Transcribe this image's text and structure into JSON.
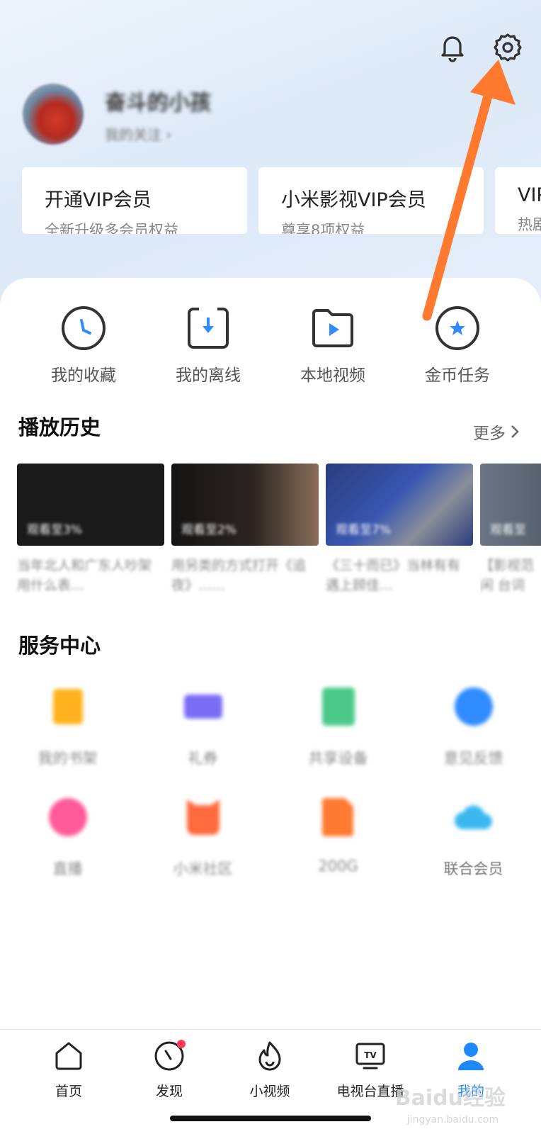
{
  "profile": {
    "nickname": "奋斗的小孩",
    "follow": "我的关注 ›"
  },
  "vip_cards": [
    {
      "title": "开通VIP会员",
      "subtitle": "全新升级多会员权益"
    },
    {
      "title": "小米影视VIP会员",
      "subtitle": "尊享8项权益"
    },
    {
      "title": "VIP",
      "subtitle": "热剧"
    }
  ],
  "quick_actions": [
    {
      "label": "我的收藏",
      "icon": "clock-icon"
    },
    {
      "label": "我的离线",
      "icon": "download-icon"
    },
    {
      "label": "本地视频",
      "icon": "folder-play-icon"
    },
    {
      "label": "金币任务",
      "icon": "star-coin-icon"
    }
  ],
  "history": {
    "title": "播放历史",
    "more": "更多",
    "items": [
      {
        "progress": "观看至3%",
        "title": "当年北人和广东人吵架用什么表…"
      },
      {
        "progress": "观看至2%",
        "title": "用另类的方式打开《追夜》……"
      },
      {
        "progress": "观看至7%",
        "title": "《三十而已》当林有有遇上顾佳…"
      },
      {
        "progress": "观看至",
        "title": "【影视范闲 台词"
      }
    ]
  },
  "services": {
    "title": "服务中心",
    "items": [
      {
        "label": "我的书架",
        "icon": "bookshelf-icon",
        "color": "#ffb21e"
      },
      {
        "label": "礼券",
        "icon": "coupon-icon",
        "color": "#7b6cf6"
      },
      {
        "label": "共享设备",
        "icon": "share-device-icon",
        "color": "#4cc98a"
      },
      {
        "label": "意见反馈",
        "icon": "feedback-icon",
        "color": "#2f8bff"
      },
      {
        "label": "直播",
        "icon": "live-icon",
        "color": "#ff5b9a"
      },
      {
        "label": "小米社区",
        "icon": "mi-community-icon",
        "color": "#ff6a3d"
      },
      {
        "label": "200G",
        "icon": "sim-card-icon",
        "color": "#ff7a32"
      },
      {
        "label": "联合会员",
        "icon": "cloud-icon",
        "color": "#3bb8f0"
      }
    ]
  },
  "nav": [
    {
      "label": "首页",
      "icon": "home-icon"
    },
    {
      "label": "发现",
      "icon": "compass-icon"
    },
    {
      "label": "小视频",
      "icon": "flame-icon"
    },
    {
      "label": "电视台直播",
      "icon": "tv-icon"
    },
    {
      "label": "我的",
      "icon": "user-icon"
    }
  ],
  "watermark": {
    "text": "Baidu经验",
    "sub": "jingyan.baidu.com"
  },
  "colors": {
    "accent": "#1e88ff",
    "arrow": "#ff7a2e"
  }
}
